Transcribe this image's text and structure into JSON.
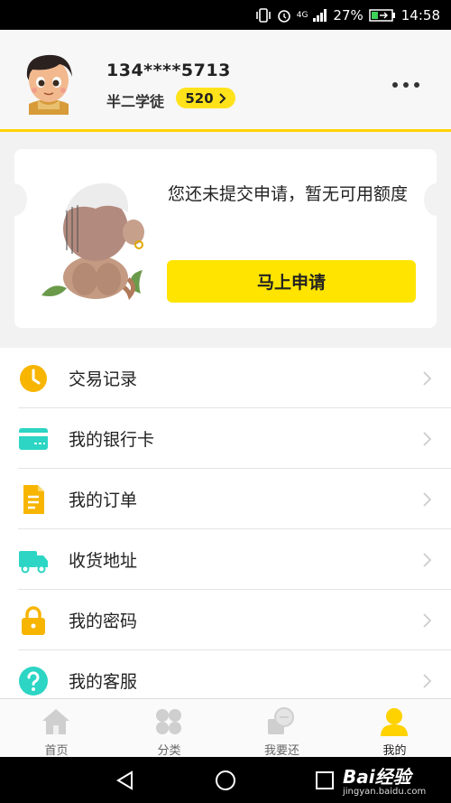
{
  "status_bar": {
    "battery": "27%",
    "time": "14:58",
    "network": "4G"
  },
  "profile": {
    "phone": "134****5713",
    "nickname": "半二学徒",
    "points": "520"
  },
  "card": {
    "message": "您还未提交申请，暂无可用额度",
    "apply_button": "马上申请"
  },
  "menu": {
    "items": [
      {
        "label": "交易记录",
        "icon": "clock-icon",
        "color": "#f7b500"
      },
      {
        "label": "我的银行卡",
        "icon": "bank-card-icon",
        "color": "#2cd5c4"
      },
      {
        "label": "我的订单",
        "icon": "document-icon",
        "color": "#f7b500"
      },
      {
        "label": "收货地址",
        "icon": "truck-icon",
        "color": "#2cd5c4"
      },
      {
        "label": "我的密码",
        "icon": "lock-icon",
        "color": "#f7b500"
      },
      {
        "label": "我的客服",
        "icon": "question-icon",
        "color": "#2cd5c4"
      }
    ]
  },
  "tabbar": {
    "tabs": [
      {
        "label": "首页",
        "icon": "home-icon"
      },
      {
        "label": "分类",
        "icon": "category-icon"
      },
      {
        "label": "我要还",
        "icon": "repay-icon"
      },
      {
        "label": "我的",
        "icon": "user-icon",
        "active": true
      }
    ]
  },
  "watermark": {
    "brand": "Bai经验",
    "url": "jingyan.baidu.com"
  },
  "colors": {
    "accent": "#ffe400",
    "teal": "#2cd5c4",
    "orange": "#f7b500"
  }
}
